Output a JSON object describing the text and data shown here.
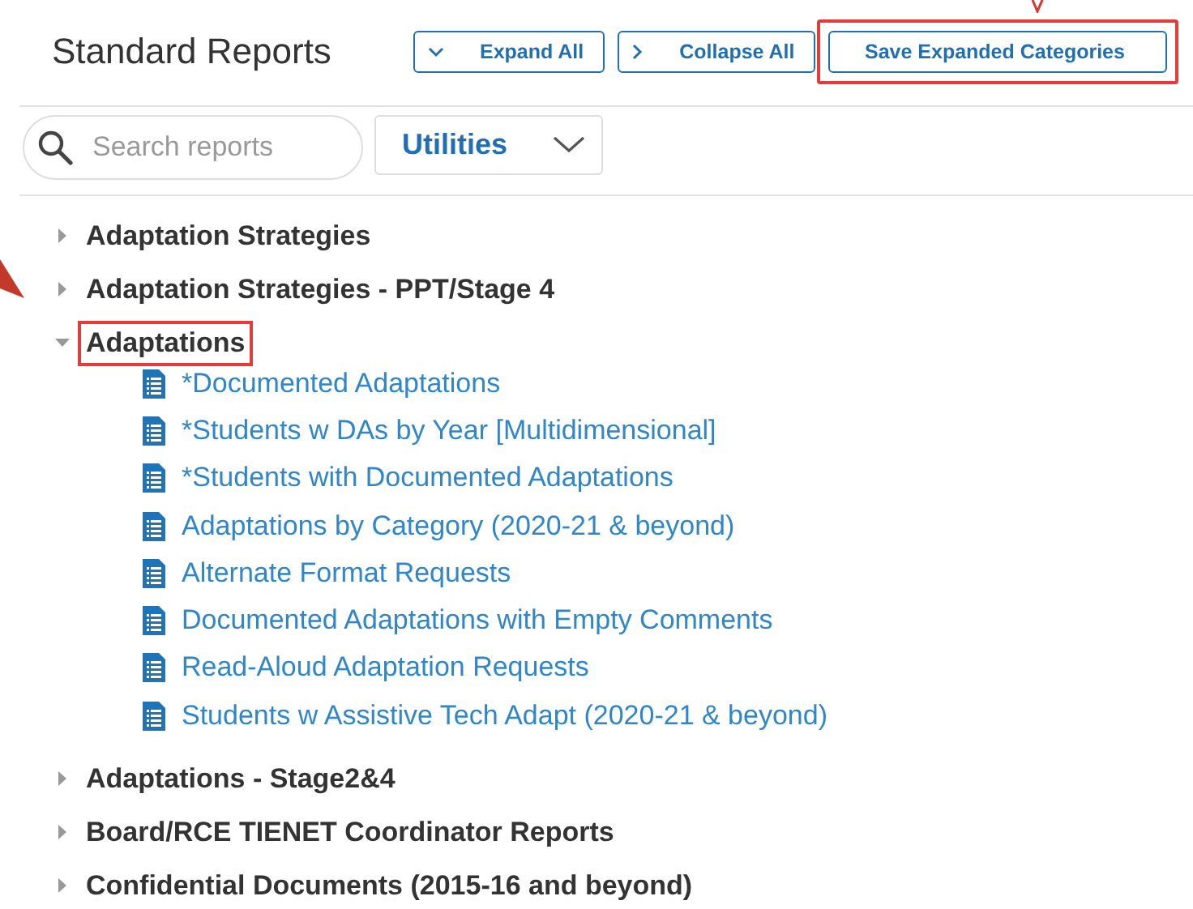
{
  "header": {
    "title": "Standard Reports",
    "buttons": [
      {
        "label": "Expand All",
        "kind": "expand",
        "highlighted": false
      },
      {
        "label": "Collapse All",
        "kind": "collapse",
        "highlighted": false
      },
      {
        "label": "Save Expanded Categories",
        "kind": "plain",
        "highlighted": true
      }
    ]
  },
  "search": {
    "placeholder": "Search reports"
  },
  "category_filter": {
    "value": "Utilities"
  },
  "tree": [
    {
      "label": "Adaptation Strategies",
      "expanded": false,
      "highlighted": false
    },
    {
      "label": "Adaptation Strategies - PPT/Stage 4",
      "expanded": false,
      "highlighted": false
    },
    {
      "label": "Adaptations",
      "expanded": true,
      "highlighted": true,
      "children": [
        {
          "label": "*Documented Adaptations"
        },
        {
          "label": "*Students w DAs by Year [Multidimensional]"
        },
        {
          "label": "*Students with Documented Adaptations"
        },
        {
          "label": "Adaptations by Category (2020-21 & beyond)"
        },
        {
          "label": "Alternate Format Requests"
        },
        {
          "label": "Documented Adaptations with Empty Comments"
        },
        {
          "label": "Read-Aloud Adaptation Requests"
        },
        {
          "label": "Students w Assistive Tech Adapt (2020-21 & beyond)"
        }
      ]
    },
    {
      "label": "Adaptations - Stage2&4",
      "expanded": false,
      "highlighted": false
    },
    {
      "label": "Board/RCE TIENET Coordinator Reports",
      "expanded": false,
      "highlighted": false
    },
    {
      "label": "Confidential Documents (2015-16 and beyond)",
      "expanded": false,
      "highlighted": false
    }
  ]
}
